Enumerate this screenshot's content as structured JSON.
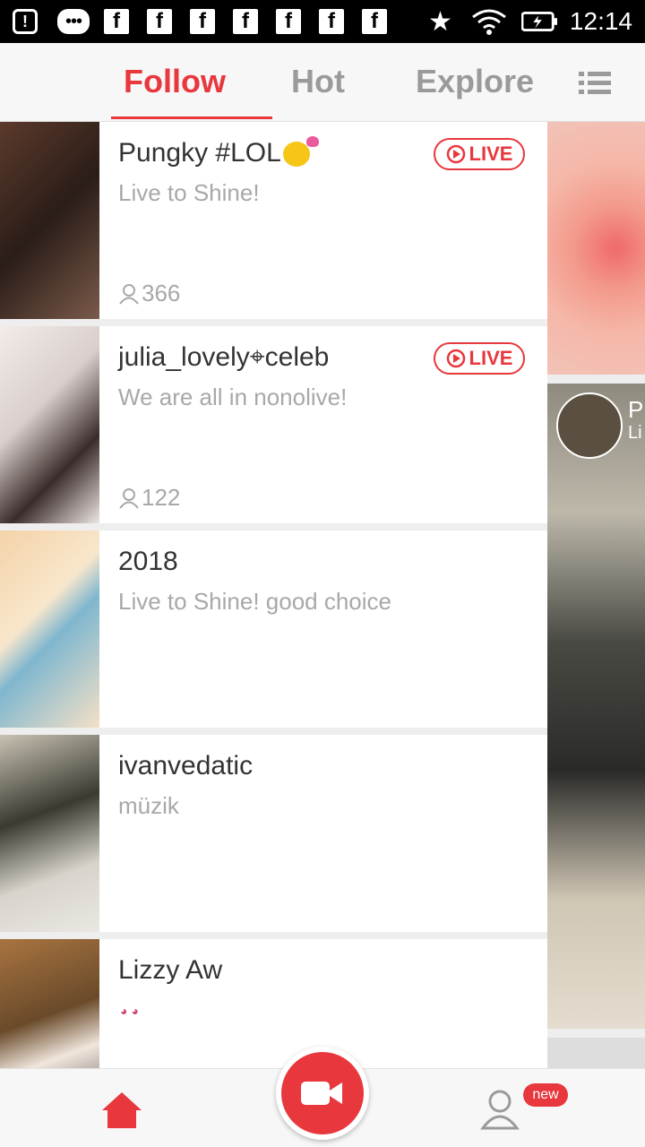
{
  "status_bar": {
    "time": "12:14",
    "fb_icons": [
      "f",
      "f",
      "f",
      "f",
      "f",
      "f",
      "f"
    ]
  },
  "tabs": [
    {
      "label": "Follow",
      "active": true
    },
    {
      "label": "Hot",
      "active": false
    },
    {
      "label": "Explore",
      "active": false
    }
  ],
  "live_label": "LIVE",
  "rows": [
    {
      "name": "Pungky #LOL",
      "status": "Live to Shine!",
      "viewers": "366",
      "live": true
    },
    {
      "name": "julia_lovely⌖celeb",
      "status": "We are all in nonolive!",
      "viewers": "122",
      "live": true
    },
    {
      "name": "2018",
      "status": "Live to Shine! good choice",
      "viewers": "",
      "live": false
    },
    {
      "name": "ivanvedatic",
      "status": "müzik",
      "viewers": "",
      "live": false
    },
    {
      "name": "Lizzy Aw",
      "status": "",
      "viewers": "",
      "live": false
    }
  ],
  "right_card": {
    "name": "P",
    "sub": "Li"
  },
  "bottom": {
    "new_badge": "new"
  },
  "colors": {
    "accent": "#e8373d",
    "inactive": "#9a9a9a"
  }
}
